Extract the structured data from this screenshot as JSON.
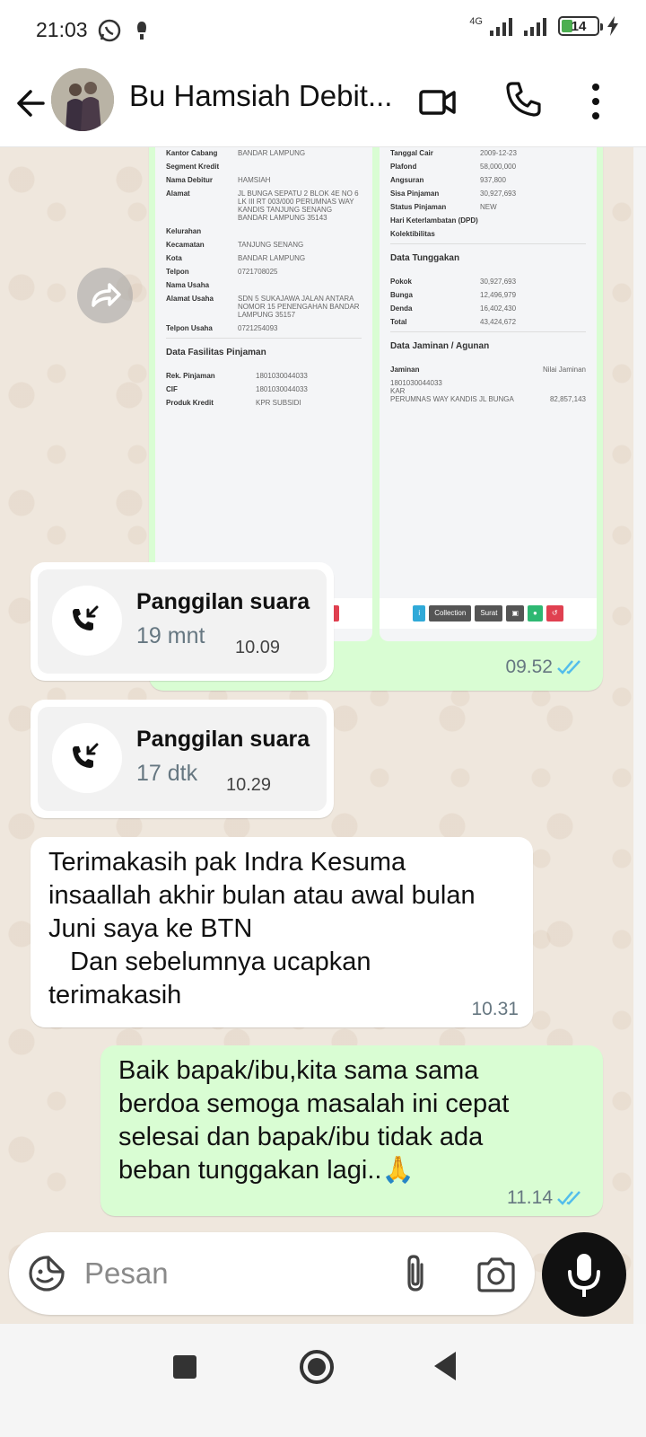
{
  "status_bar": {
    "time": "21:03",
    "network": "4G",
    "battery": "14"
  },
  "header": {
    "contact_name": "Bu Hamsiah Debit...",
    "icons": [
      "back-arrow-icon",
      "video-call-icon",
      "phone-icon",
      "more-vert-icon"
    ]
  },
  "image_message": {
    "time": "09.52",
    "left_shot": {
      "rows": [
        {
          "k": "Kantor Cabang",
          "v": "BANDAR LAMPUNG"
        },
        {
          "k": "Segment Kredit",
          "v": ""
        },
        {
          "k": "Nama Debitur",
          "v": "HAMSIAH"
        },
        {
          "k": "Alamat",
          "v": "JL BUNGA SEPATU 2 BLOK 4E NO 6 LK III RT 003/000 PERUMNAS WAY KANDIS TANJUNG SENANG BANDAR LAMPUNG 35143"
        },
        {
          "k": "Kelurahan",
          "v": ""
        },
        {
          "k": "Kecamatan",
          "v": "TANJUNG SENANG"
        },
        {
          "k": "Kota",
          "v": "BANDAR LAMPUNG"
        },
        {
          "k": "Telpon",
          "v": "0721708025"
        },
        {
          "k": "Nama Usaha",
          "v": ""
        },
        {
          "k": "Alamat Usaha",
          "v": "SDN 5 SUKAJAWA JALAN ANTARA NOMOR 15 PENENGAHAN BANDAR LAMPUNG 35157"
        },
        {
          "k": "Telpon Usaha",
          "v": "0721254093"
        }
      ],
      "section": "Data Fasilitas Pinjaman",
      "rows2": [
        {
          "k": "Rek. Pinjaman",
          "v": "1801030044033"
        },
        {
          "k": "CIF",
          "v": "1801030044033"
        },
        {
          "k": "Produk Kredit",
          "v": "KPR SUBSIDI"
        }
      ]
    },
    "right_shot": {
      "rows": [
        {
          "k": "Tanggal Cair",
          "v": "2009-12-23"
        },
        {
          "k": "Plafond",
          "v": "58,000,000"
        },
        {
          "k": "Angsuran",
          "v": "937,800"
        },
        {
          "k": "Sisa Pinjaman",
          "v": "30,927,693"
        },
        {
          "k": "Status Pinjaman",
          "v": "NEW"
        },
        {
          "k": "Hari Keterlambatan (DPD)",
          "v": ""
        },
        {
          "k": "Kolektibilitas",
          "v": ""
        }
      ],
      "section": "Data Tunggakan",
      "rows2": [
        {
          "k": "Pokok",
          "v": "30,927,693"
        },
        {
          "k": "Bunga",
          "v": "12,496,979"
        },
        {
          "k": "Denda",
          "v": "16,402,430"
        },
        {
          "k": "Total",
          "v": "43,424,672"
        }
      ],
      "section2": "Data Jaminan / Agunan",
      "jaminan_header": {
        "k": "Jaminan",
        "v": "Nilai Jaminan"
      },
      "jaminan_lines": [
        "1801030044033",
        "KAR",
        "PERUMNAS WAY KANDIS JL BUNGA"
      ],
      "jaminan_value": "82,857,143"
    },
    "buttons": [
      "i",
      "Collection",
      "Surat",
      "▣",
      "●",
      "↺"
    ]
  },
  "calls": [
    {
      "label": "Panggilan suara",
      "duration": "19 mnt",
      "time": "10.09"
    },
    {
      "label": "Panggilan suara",
      "duration": "17 dtk",
      "time": "10.29"
    }
  ],
  "incoming_message": {
    "text": "Terimakasih pak Indra Kesuma\ninsaallah akhir bulan atau awal bulan\nJuni saya ke BTN\n   Dan sebelumnya ucapkan\nterimakasih",
    "time": "10.31"
  },
  "outgoing_message": {
    "text": "Baik bapak/ibu,kita sama sama\nberdoa semoga masalah ini cepat\nselesai dan bapak/ibu tidak ada\nbeban tunggakan lagi..🙏",
    "time": "11.14"
  },
  "composer": {
    "placeholder": "Pesan"
  },
  "colors": {
    "chat_bg": "#efe7dd",
    "outgoing": "#d9fdd3",
    "incoming": "#ffffff",
    "read_tick": "#53bdeb"
  }
}
